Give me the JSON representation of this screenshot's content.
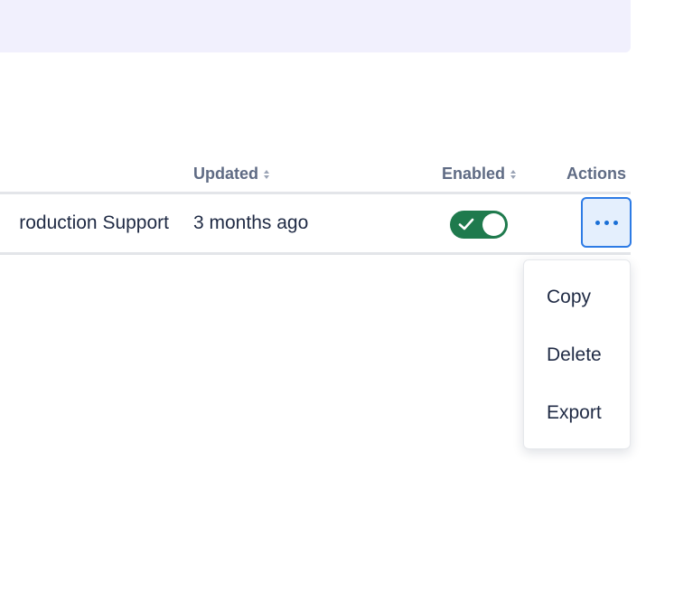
{
  "table": {
    "headers": {
      "updated": "Updated",
      "enabled": "Enabled",
      "actions": "Actions"
    },
    "rows": [
      {
        "name": "roduction Support",
        "updated": "3 months ago",
        "enabled": true
      }
    ]
  },
  "actions_menu": {
    "items": [
      "Copy",
      "Delete",
      "Export"
    ]
  },
  "colors": {
    "banner": "#f1f0fd",
    "toggle_on": "#1f7a4d",
    "focus_ring": "#2d7be5",
    "header_text": "#5f6b84",
    "body_text": "#1f2a44"
  },
  "icons": {
    "sort": "sort-icon",
    "toggle_check": "check-icon",
    "actions": "more-horizontal-icon"
  }
}
